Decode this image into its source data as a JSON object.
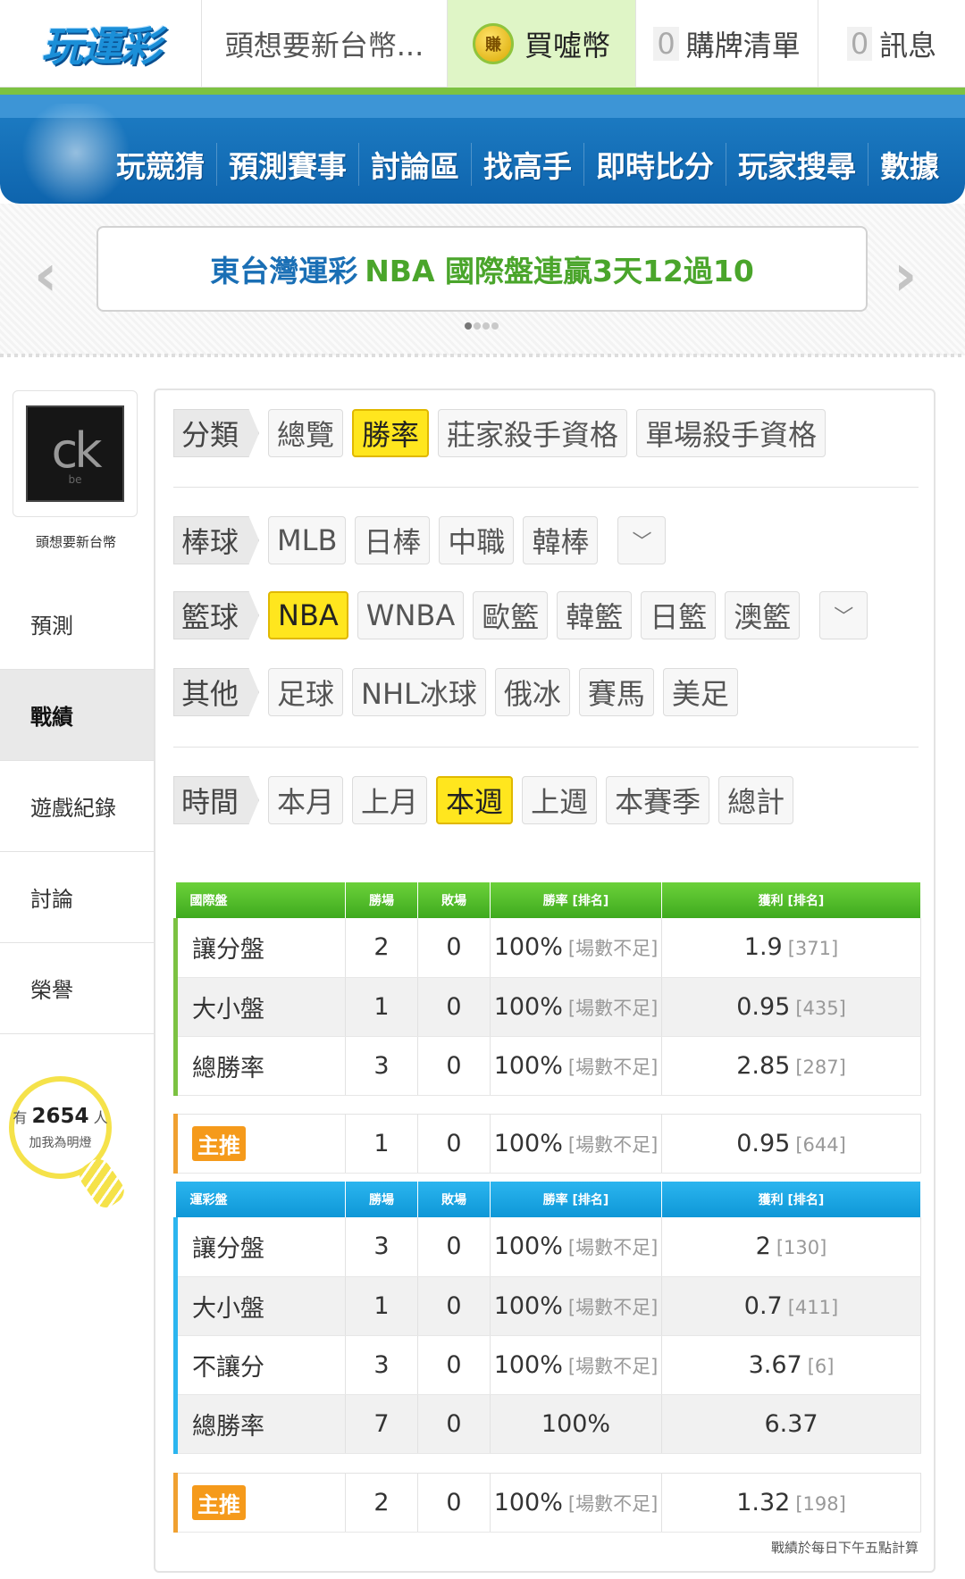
{
  "header": {
    "logo": "玩運彩",
    "user": "頭想要新台幣...",
    "buy_coin_icon": "賺",
    "buy_coin": "買噓幣",
    "cart_count": "0",
    "cart_label": "購牌清單",
    "msg_count": "0",
    "msg_label": "訊息"
  },
  "nav": [
    "玩競猜",
    "預測賽事",
    "討論區",
    "找高手",
    "即時比分",
    "玩家搜尋",
    "數據"
  ],
  "banner": {
    "part1": "東台灣運彩",
    "part2": "NBA 國際盤連贏3天12過10"
  },
  "profile": {
    "avatar_text": "ck",
    "avatar_sub": "be",
    "name": "頭想要新台幣",
    "menu": [
      "預測",
      "戰績",
      "遊戲紀錄",
      "討論",
      "榮譽"
    ],
    "fans_prefix": "有",
    "fans_count": "2654",
    "fans_unit": "人",
    "fans_cta": "加我為明燈"
  },
  "filters": {
    "category": {
      "label": "分類",
      "options": [
        "總覽",
        "勝率",
        "莊家殺手資格",
        "單場殺手資格"
      ],
      "selected": "勝率"
    },
    "baseball": {
      "label": "棒球",
      "options": [
        "MLB",
        "日棒",
        "中職",
        "韓棒"
      ]
    },
    "basketball": {
      "label": "籃球",
      "options": [
        "NBA",
        "WNBA",
        "歐籃",
        "韓籃",
        "日籃",
        "澳籃"
      ],
      "selected": "NBA"
    },
    "other": {
      "label": "其他",
      "options": [
        "足球",
        "NHL冰球",
        "俄冰",
        "賽馬",
        "美足"
      ]
    },
    "time": {
      "label": "時間",
      "options": [
        "本月",
        "上月",
        "本週",
        "上週",
        "本賽季",
        "總計"
      ],
      "selected": "本週"
    }
  },
  "international": {
    "headers": [
      "國際盤",
      "勝場",
      "敗場",
      "勝率 [排名]",
      "獲利 [排名]"
    ],
    "rows": [
      {
        "label": "讓分盤",
        "win": "2",
        "lose": "0",
        "rate": "100%",
        "rate_rank": "[場數不足]",
        "profit": "1.9",
        "profit_rank": "[371]"
      },
      {
        "label": "大小盤",
        "win": "1",
        "lose": "0",
        "rate": "100%",
        "rate_rank": "[場數不足]",
        "profit": "0.95",
        "profit_rank": "[435]"
      },
      {
        "label": "總勝率",
        "win": "3",
        "lose": "0",
        "rate": "100%",
        "rate_rank": "[場數不足]",
        "profit": "2.85",
        "profit_rank": "[287]"
      }
    ],
    "main": {
      "label": "主推",
      "win": "1",
      "lose": "0",
      "rate": "100%",
      "rate_rank": "[場數不足]",
      "profit": "0.95",
      "profit_rank": "[644]"
    }
  },
  "lottery": {
    "headers": [
      "運彩盤",
      "勝場",
      "敗場",
      "勝率 [排名]",
      "獲利 [排名]"
    ],
    "rows": [
      {
        "label": "讓分盤",
        "win": "3",
        "lose": "0",
        "rate": "100%",
        "rate_rank": "[場數不足]",
        "profit": "2",
        "profit_rank": "[130]"
      },
      {
        "label": "大小盤",
        "win": "1",
        "lose": "0",
        "rate": "100%",
        "rate_rank": "[場數不足]",
        "profit": "0.7",
        "profit_rank": "[411]"
      },
      {
        "label": "不讓分",
        "win": "3",
        "lose": "0",
        "rate": "100%",
        "rate_rank": "[場數不足]",
        "profit": "3.67",
        "profit_rank": "[6]"
      },
      {
        "label": "總勝率",
        "win": "7",
        "lose": "0",
        "rate": "100%",
        "rate_rank": "",
        "profit": "6.37",
        "profit_rank": ""
      }
    ],
    "main": {
      "label": "主推",
      "win": "2",
      "lose": "0",
      "rate": "100%",
      "rate_rank": "[場數不足]",
      "profit": "1.32",
      "profit_rank": "[198]"
    }
  },
  "footnote": "戰績於每日下午五點計算"
}
